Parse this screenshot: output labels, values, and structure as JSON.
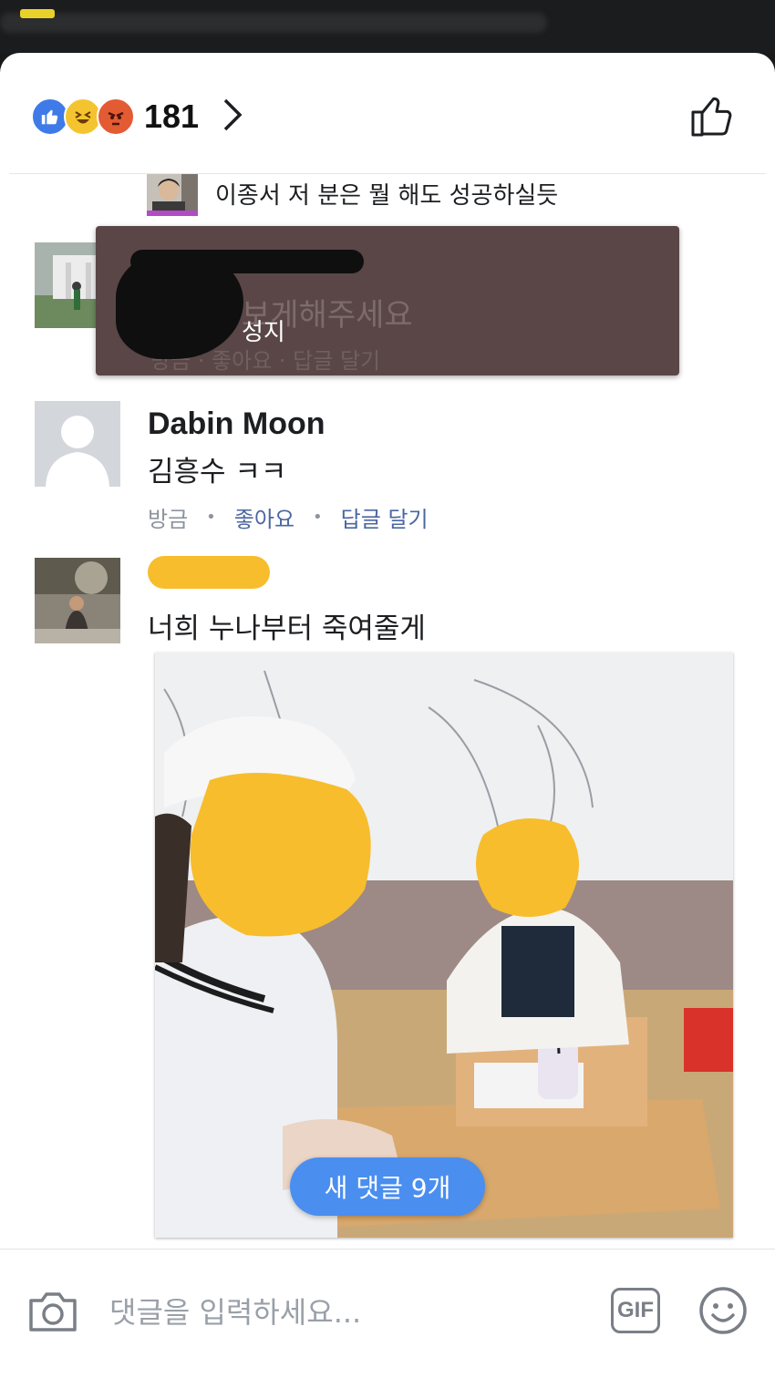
{
  "reactions": {
    "count": "181",
    "icons": [
      "like-icon",
      "haha-icon",
      "angry-icon"
    ]
  },
  "comments": [
    {
      "text": "이종서 저 분은 뭘 해도 성공하실듯"
    },
    {
      "ghost_text": "보게해주세요",
      "ghost_meta": "방금 · 좋아요 · 답글 달기"
    },
    {
      "name": "Dabin Moon",
      "text": "김흥수 ㅋㅋ",
      "time": "방금",
      "like": "좋아요",
      "reply": "답글 달기"
    },
    {
      "text": "너희 누나부터 죽여줄게"
    }
  ],
  "tooltip": {
    "text": "성지"
  },
  "new_comments_button": "새 댓글 9개",
  "composer": {
    "placeholder": "댓글을 입력하세요...",
    "gif_label": "GIF"
  },
  "colors": {
    "accent": "#4a8ef0",
    "link": "#4b67a1",
    "like": "#3f7be8",
    "tooltip_bg": "#5a4646"
  }
}
